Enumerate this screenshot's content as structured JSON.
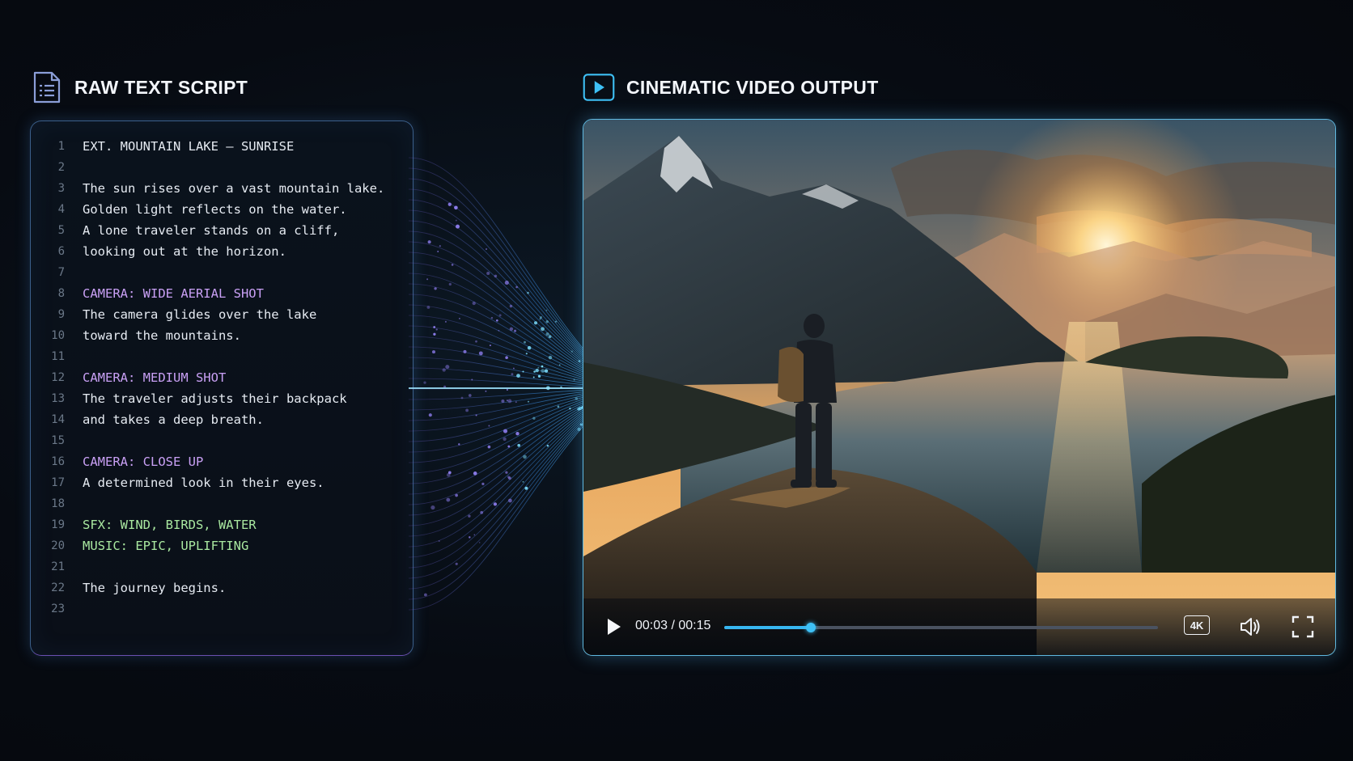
{
  "script_panel": {
    "title": "RAW TEXT SCRIPT",
    "icon": "document-icon",
    "lines": [
      {
        "n": "1",
        "text": "EXT. MOUNTAIN LAKE – SUNRISE",
        "kind": "normal"
      },
      {
        "n": "2",
        "text": "",
        "kind": "normal"
      },
      {
        "n": "3",
        "text": "The sun rises over a vast mountain lake.",
        "kind": "normal"
      },
      {
        "n": "4",
        "text": "Golden light reflects on the water.",
        "kind": "normal"
      },
      {
        "n": "5",
        "text": "A lone traveler stands on a cliff,",
        "kind": "normal"
      },
      {
        "n": "6",
        "text": "looking out at the horizon.",
        "kind": "normal"
      },
      {
        "n": "7",
        "text": "",
        "kind": "normal"
      },
      {
        "n": "8",
        "text": "CAMERA: WIDE AERIAL SHOT",
        "kind": "camera"
      },
      {
        "n": "9",
        "text": "The camera glides over the lake",
        "kind": "normal"
      },
      {
        "n": "10",
        "text": "toward the mountains.",
        "kind": "normal"
      },
      {
        "n": "11",
        "text": "",
        "kind": "normal"
      },
      {
        "n": "12",
        "text": "CAMERA: MEDIUM SHOT",
        "kind": "camera"
      },
      {
        "n": "13",
        "text": "The traveler adjusts their backpack",
        "kind": "normal"
      },
      {
        "n": "14",
        "text": "and takes a deep breath.",
        "kind": "normal"
      },
      {
        "n": "15",
        "text": "",
        "kind": "normal"
      },
      {
        "n": "16",
        "text": "CAMERA: CLOSE UP",
        "kind": "camera"
      },
      {
        "n": "17",
        "text": "A determined look in their eyes.",
        "kind": "normal"
      },
      {
        "n": "18",
        "text": "",
        "kind": "normal"
      },
      {
        "n": "19",
        "text": "SFX: WIND, BIRDS, WATER",
        "kind": "audio"
      },
      {
        "n": "20",
        "text": "MUSIC: EPIC, UPLIFTING",
        "kind": "audio"
      },
      {
        "n": "21",
        "text": "",
        "kind": "normal"
      },
      {
        "n": "22",
        "text": "The journey begins.",
        "kind": "normal"
      },
      {
        "n": "23",
        "text": "",
        "kind": "normal"
      }
    ]
  },
  "video_panel": {
    "title": "CINEMATIC VIDEO OUTPUT",
    "icon": "play-icon",
    "player": {
      "time": "00:03 / 00:15",
      "progress_fraction": 0.2,
      "quality_label": "4K",
      "play_icon": "play-icon",
      "volume_icon": "volume-icon",
      "fullscreen_icon": "fullscreen-icon"
    }
  },
  "colors": {
    "accent": "#37b6f0",
    "camera": "#c9a0f5",
    "audio": "#a9e8a0"
  }
}
